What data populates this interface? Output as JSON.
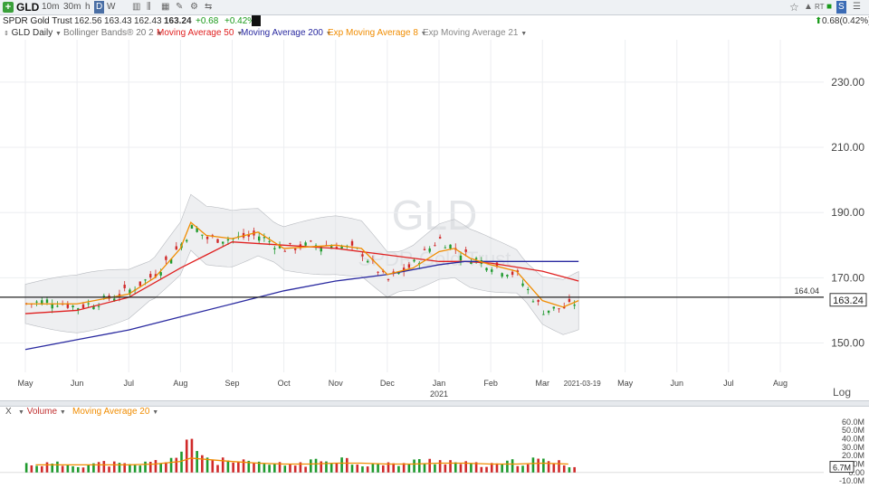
{
  "toolbar": {
    "symbol": "GLD",
    "intervals": [
      "10m",
      "30m",
      "h",
      "D",
      "W"
    ],
    "selected_interval": "D",
    "name": "SPDR Gold Trust",
    "open": "162.56",
    "high": "163.43",
    "low": "162.43",
    "close": "163.24",
    "change": "+0.68",
    "change_pct": "+0.42%",
    "right_change": "0.68(0.42%)",
    "accent_up": "#1a9a1a"
  },
  "indicators": {
    "chart_label": "GLD Daily",
    "bollinger": "Bollinger Bands® 20 2",
    "ma50": "Moving Average 50",
    "ma200": "Moving Average 200",
    "ema8": "Exp Moving Average 8",
    "ema21": "Exp Moving Average 21",
    "colors": {
      "ma50": "#e02020",
      "ma200": "#2a2aa0",
      "ema8": "#f08c00",
      "ema21": "#888888"
    }
  },
  "volume_panel": {
    "close_label": "X",
    "volume_label": "Volume",
    "ma_label": "Moving Average 20",
    "current_label": "6.7M"
  },
  "axis": {
    "log_label": "Log",
    "year_label": "2021",
    "last_date": "2021-03-19",
    "line_label": "164.04",
    "price_label": "163.24"
  },
  "watermark": {
    "symbol": "GLD",
    "name": "SPDR Gold Trust"
  },
  "chart_data": {
    "type": "line",
    "price_ticks": [
      150,
      170,
      190,
      210,
      230
    ],
    "price_tick_labels": [
      "150.00",
      "170.00",
      "190.00",
      "210.00",
      "230.00"
    ],
    "month_labels": [
      "May",
      "Jun",
      "Jul",
      "Aug",
      "Sep",
      "Oct",
      "Nov",
      "Dec",
      "Jan",
      "Feb",
      "Mar",
      "May",
      "Jun",
      "Jul",
      "Aug"
    ],
    "horizontal_line": 164.04,
    "last_price": 163.24,
    "ylim": [
      141,
      243
    ],
    "x_months": [
      0,
      1,
      2,
      3,
      4,
      5,
      6,
      7,
      8,
      9,
      10,
      11.6,
      12.6,
      13.6,
      14.6
    ],
    "price_series": {
      "x": [
        0,
        0.5,
        1,
        1.5,
        2,
        2.5,
        3,
        3.25,
        3.5,
        4,
        4.5,
        5,
        5.5,
        6,
        6.5,
        7,
        7.5,
        8,
        8.5,
        9,
        9.5,
        10,
        10.5,
        10.7
      ],
      "close": [
        162,
        163,
        161,
        163,
        166,
        171,
        180,
        186,
        182,
        182,
        183,
        179,
        180,
        180,
        178,
        169,
        174,
        182,
        177,
        174,
        171,
        160,
        161,
        163.24
      ]
    },
    "series": [
      {
        "name": "Moving Average 50",
        "x": [
          0,
          1,
          2,
          3,
          3.5,
          4,
          5,
          6,
          7,
          8,
          8.5,
          9,
          10,
          10.7
        ],
        "values": [
          159,
          160,
          164,
          173,
          177,
          181,
          180,
          179,
          177,
          175,
          175,
          174.5,
          172,
          169
        ]
      },
      {
        "name": "Moving Average 200",
        "x": [
          0,
          1,
          2,
          3,
          4,
          5,
          6,
          7,
          8,
          8.5,
          9,
          10,
          10.7
        ],
        "values": [
          148,
          151,
          154,
          158,
          162,
          166,
          169,
          171,
          174,
          175,
          175,
          175,
          175
        ]
      },
      {
        "name": "Exp Moving Average 8",
        "x": [
          0,
          1,
          2,
          2.5,
          3,
          3.2,
          3.5,
          4,
          4.5,
          5,
          6,
          6.5,
          7,
          7.5,
          8,
          8.3,
          8.6,
          9,
          9.5,
          10,
          10.4,
          10.7
        ],
        "values": [
          162,
          162,
          165,
          170,
          179,
          187,
          183,
          182,
          184,
          179,
          180,
          179,
          171,
          173,
          178,
          179,
          176,
          174,
          172,
          163,
          161,
          163
        ]
      }
    ],
    "volume": {
      "ticks_labels": [
        "60.0M",
        "50.0M",
        "40.0M",
        "30.0M",
        "20.0M",
        "10.0M",
        "0.00",
        "-10.0M"
      ],
      "ticks": [
        60,
        50,
        40,
        30,
        20,
        10,
        0,
        -10
      ],
      "ylim": [
        -12,
        63
      ],
      "x": [
        0.2,
        1,
        1.6,
        2,
        2.5,
        3,
        3.2,
        3.6,
        4,
        4.5,
        5,
        5.5,
        6,
        6.5,
        7,
        7.5,
        8,
        8.5,
        9,
        9.5,
        10,
        10.5
      ],
      "values": [
        10,
        9,
        11,
        8,
        12,
        20,
        35,
        14,
        12,
        10,
        9,
        11,
        18,
        10,
        9,
        12,
        15,
        10,
        8,
        12,
        14,
        9
      ],
      "ma20": [
        9,
        9,
        9,
        9,
        10,
        13,
        17,
        15,
        13,
        11,
        10,
        10,
        11,
        11,
        10,
        10,
        11,
        11,
        10,
        10,
        11,
        10
      ]
    }
  }
}
